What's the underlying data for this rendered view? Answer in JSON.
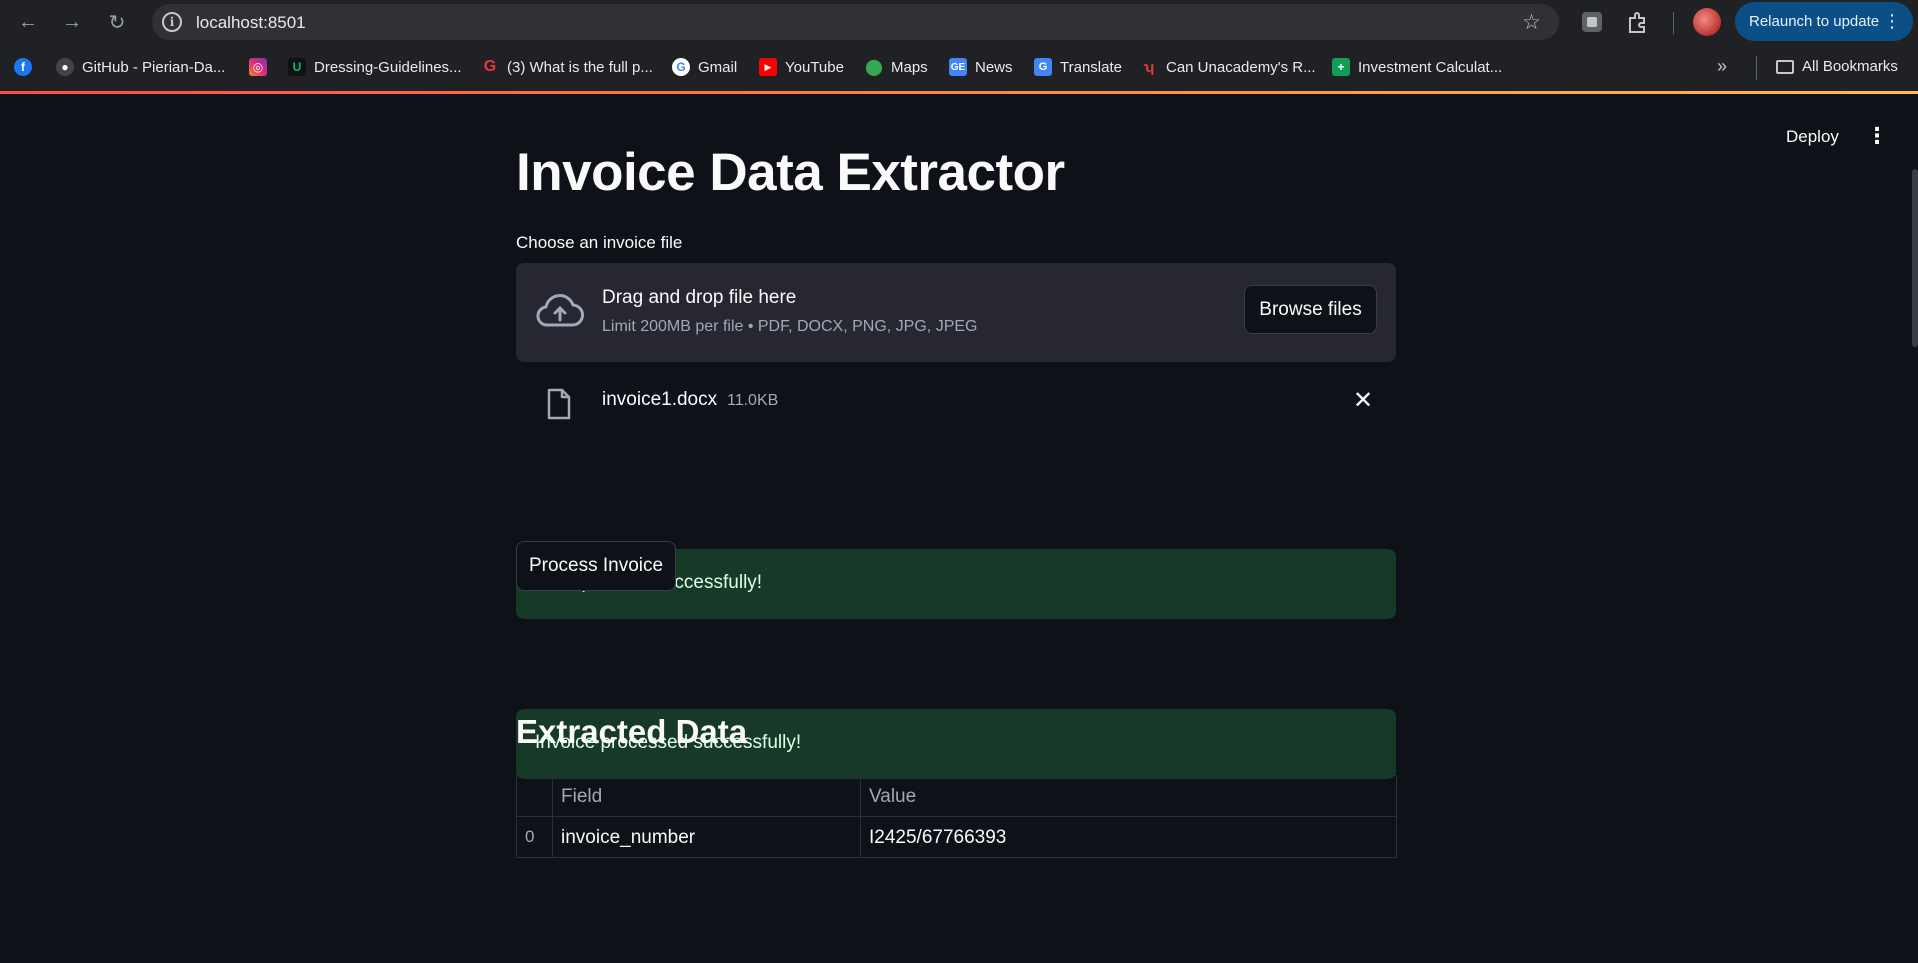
{
  "browser": {
    "url": "localhost:8501",
    "relaunch_label": "Relaunch to update",
    "bookmarks": [
      {
        "label": "GitHub - Pierian-Da...",
        "icon": "github-icon"
      },
      {
        "label": "Dressing-Guidelines...",
        "icon": "unacademy-icon"
      },
      {
        "label": "(3) What is the full p...",
        "icon": "quora-icon"
      },
      {
        "label": "Gmail",
        "icon": "google-icon"
      },
      {
        "label": "YouTube",
        "icon": "youtube-icon"
      },
      {
        "label": "Maps",
        "icon": "maps-icon"
      },
      {
        "label": "News",
        "icon": "news-icon"
      },
      {
        "label": "Translate",
        "icon": "translate-icon"
      },
      {
        "label": "Can Unacademy's R...",
        "icon": "unacademy-red-icon"
      },
      {
        "label": "Investment Calculat...",
        "icon": "sheets-icon"
      }
    ],
    "all_bookmarks_label": "All Bookmarks"
  },
  "app": {
    "deploy_label": "Deploy",
    "title": "Invoice Data Extractor",
    "uploader": {
      "label": "Choose an invoice file",
      "drag_text": "Drag and drop file here",
      "limit_text": "Limit 200MB per file • PDF, DOCX, PNG, JPG, JPEG",
      "browse_label": "Browse files"
    },
    "file": {
      "name": "invoice1.docx",
      "size": "11.0KB"
    },
    "upload_success": "File uploaded successfully!",
    "process_label": "Process Invoice",
    "process_success": "Invoice processed successfully!",
    "extracted_heading": "Extracted Data",
    "table": {
      "columns": [
        "",
        "Field",
        "Value"
      ],
      "rows": [
        [
          "0",
          "invoice_number",
          "I2425/67766393"
        ]
      ]
    }
  },
  "colors": {
    "background": "#0e1117",
    "panel": "#262730",
    "success_bg": "#173928",
    "relaunch": "#0b4f86"
  }
}
